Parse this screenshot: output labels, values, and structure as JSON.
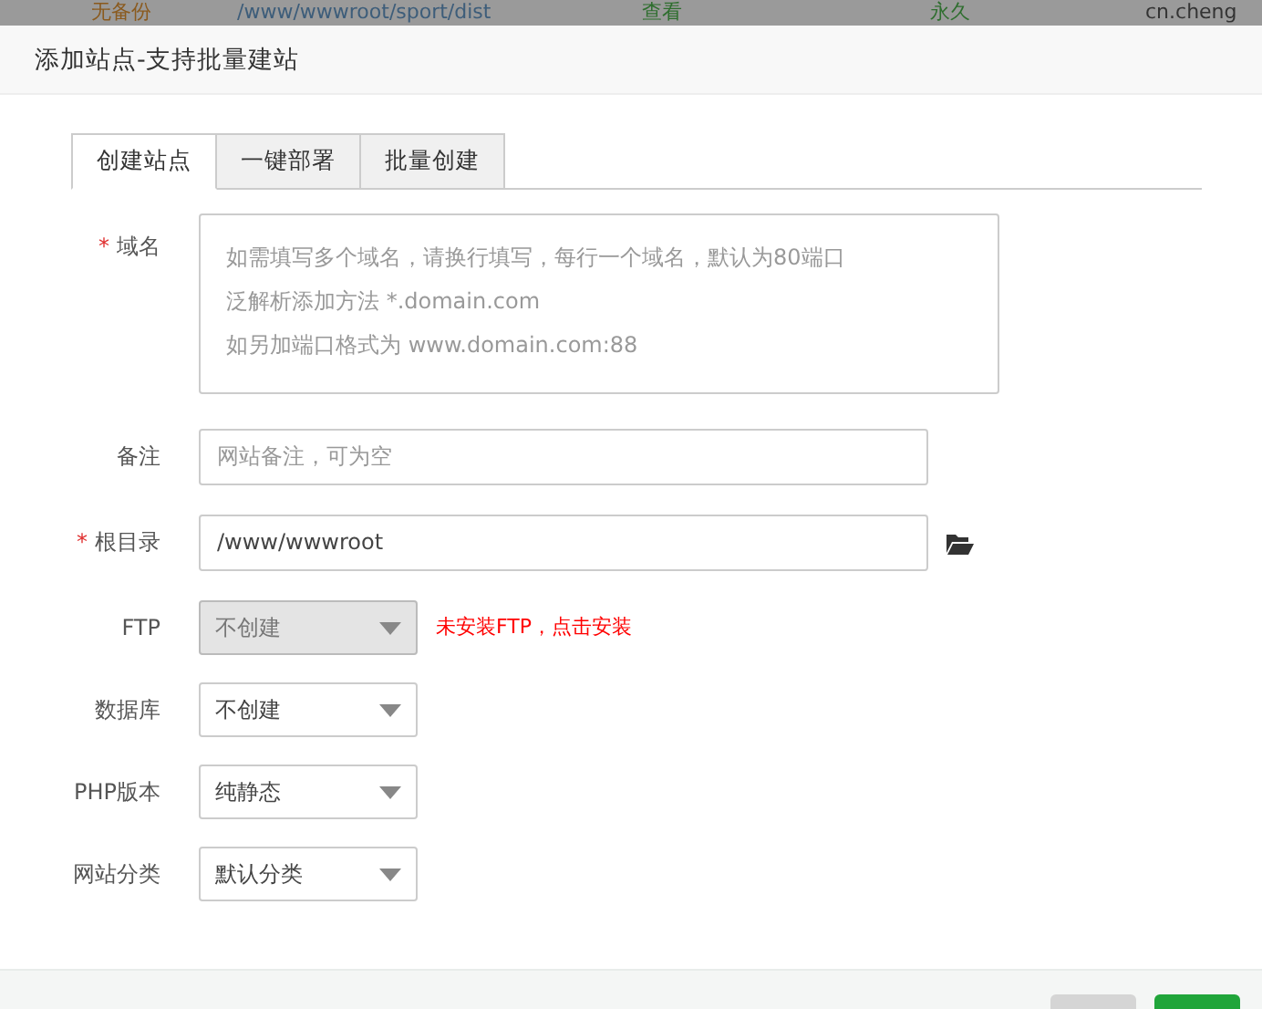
{
  "background_row": [
    "无备份",
    "/www/wwwroot/sport/dist",
    "查看",
    "永久",
    "cn.cheng"
  ],
  "dialog": {
    "title": "添加站点-支持批量建站"
  },
  "tabs": [
    {
      "label": "创建站点",
      "selected": true
    },
    {
      "label": "一键部署",
      "selected": false
    },
    {
      "label": "批量创建",
      "selected": false
    }
  ],
  "form": [
    {
      "kind": "textarea",
      "label": "域名",
      "required_mark": "*",
      "placeholder_lines": [
        "如需填写多个域名，请换行填写，每行一个域名，默认为80端口",
        "泛解析添加方法 *.domain.com",
        "如另加端口格式为 www.domain.com:88"
      ]
    },
    {
      "kind": "input",
      "label": "备注",
      "placeholder": "网站备注，可为空"
    },
    {
      "kind": "path",
      "label": "根目录",
      "required_mark": "*",
      "value": "/www/wwwroot"
    },
    {
      "kind": "select",
      "label": "FTP",
      "value": "不创建",
      "disabled": true,
      "note": "未安装FTP，点击安装"
    },
    {
      "kind": "select",
      "label": "数据库",
      "value": "不创建",
      "disabled": false
    },
    {
      "kind": "select",
      "label": "PHP版本",
      "value": "纯静态",
      "disabled": false
    },
    {
      "kind": "select",
      "label": "网站分类",
      "value": "默认分类",
      "disabled": false
    }
  ]
}
